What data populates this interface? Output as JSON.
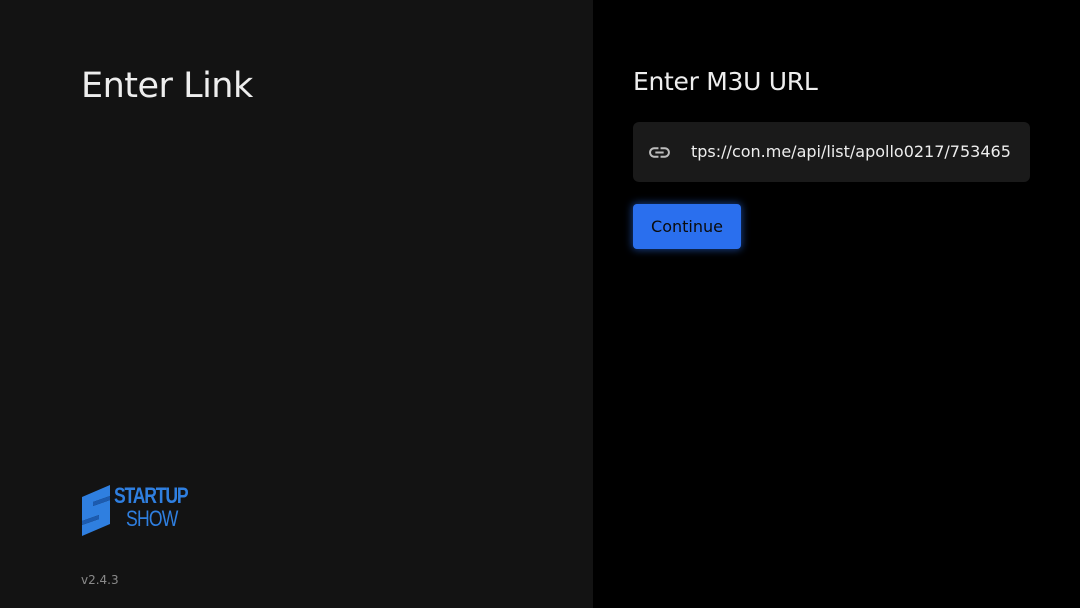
{
  "left": {
    "title": "Enter Link",
    "logo": {
      "line1": "STARTUP",
      "line2": "SHOW",
      "color": "#2f7fe0"
    },
    "version": "v2.4.3"
  },
  "right": {
    "title": "Enter M3U URL",
    "url_field": {
      "icon": "link-icon",
      "value": "tps://con.me/api/list/apollo0217/753465"
    },
    "continue_label": "Continue",
    "accent": "#2a6fee"
  }
}
